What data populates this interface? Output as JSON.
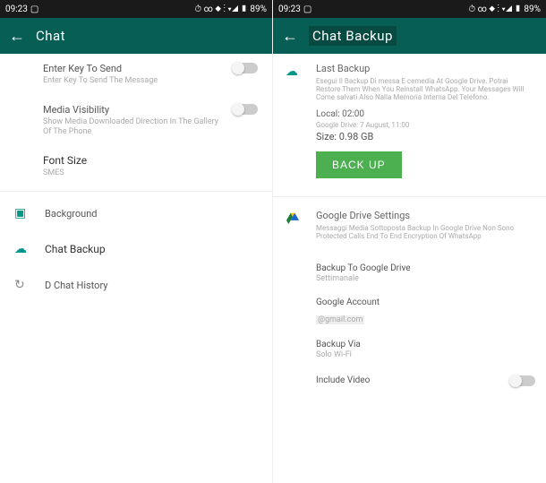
{
  "statusBar": {
    "time": "09:23",
    "battery": "89%"
  },
  "left": {
    "title": "Chat",
    "enterKey": {
      "title": "Enter Key To Send",
      "desc": "Enter Key To Send The Message"
    },
    "mediaVis": {
      "title": "Media Visibility",
      "desc": "Show Media Downloaded Direction In The Gallery Of The Phone"
    },
    "fontSize": {
      "title": "Font Size",
      "value": "SMES"
    },
    "background": "Background",
    "chatBackup": "Chat Backup",
    "chatHistory": "D Chat History"
  },
  "right": {
    "title": "Chat Backup",
    "lastBackup": {
      "title": "Last Backup",
      "desc": "Esegui Il Backup Di messa E cemedia At Google Drive. Potrai Restore Them When You Reinstall WhatsApp. Your Messages Will Come salvati Also Nalla Memoria Interna Del Telefono.",
      "local": "Local: 02:00",
      "gdrive": "Google Drive: 7 August, 11:00",
      "size": "Size: 0.98 GB"
    },
    "backupBtn": "BACK UP",
    "gdriveSettings": {
      "title": "Google Drive Settings",
      "desc": "Messaggi Media Sottoposta Backup In Google Drive Non Sono Protected Calls End To End Encryption Of WhatsApp"
    },
    "backupToDrive": {
      "title": "Backup To Google Drive",
      "value": "Settimanale"
    },
    "googleAccount": {
      "title": "Google Account",
      "value": "@gmail.com"
    },
    "backupVia": {
      "title": "Backup Via",
      "value": "Solo Wi-Fi"
    },
    "includeVideo": "Include Video"
  }
}
